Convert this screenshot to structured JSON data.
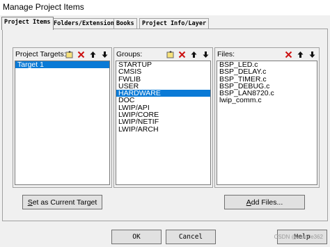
{
  "window": {
    "title": "Manage Project Items"
  },
  "tabs": [
    {
      "label": "Project Items",
      "active": true
    },
    {
      "label": "Folders/Extensions",
      "active": false
    },
    {
      "label": "Books",
      "active": false
    },
    {
      "label": "Project Info/Layer",
      "active": false
    }
  ],
  "targets": {
    "label": "Project Targets:",
    "items": [
      {
        "text": "Target 1",
        "selected": true
      }
    ],
    "tools": [
      "new-icon",
      "delete-icon",
      "move-up-icon",
      "move-down-icon"
    ]
  },
  "groups": {
    "label": "Groups:",
    "items": [
      {
        "text": "STARTUP",
        "selected": false
      },
      {
        "text": "CMSIS",
        "selected": false
      },
      {
        "text": "FWLIB",
        "selected": false
      },
      {
        "text": "USER",
        "selected": false
      },
      {
        "text": "HARDWARE",
        "selected": true
      },
      {
        "text": "DOC",
        "selected": false
      },
      {
        "text": "LWIP/API",
        "selected": false
      },
      {
        "text": "LWIP/CORE",
        "selected": false
      },
      {
        "text": "LWIP/NETIF",
        "selected": false
      },
      {
        "text": "LWIP/ARCH",
        "selected": false
      }
    ],
    "tools": [
      "new-icon",
      "delete-icon",
      "move-up-icon",
      "move-down-icon"
    ]
  },
  "files": {
    "label": "Files:",
    "items": [
      {
        "text": "BSP_LED.c",
        "selected": false
      },
      {
        "text": "BSP_DELAY.c",
        "selected": false
      },
      {
        "text": "BSP_TIMER.c",
        "selected": false
      },
      {
        "text": "BSP_DEBUG.c",
        "selected": false
      },
      {
        "text": "BSP_LAN8720.c",
        "selected": false
      },
      {
        "text": "lwip_comm.c",
        "selected": false
      }
    ],
    "tools": [
      "delete-icon",
      "move-up-icon",
      "move-down-icon"
    ]
  },
  "buttons": {
    "set_current_target": {
      "underline": "S",
      "rest": "et as Current Target"
    },
    "add_files": {
      "underline": "A",
      "rest": "dd Files..."
    },
    "ok": "OK",
    "cancel": "Cancel",
    "help": "Help"
  },
  "watermark": "CSDN @alan0e362",
  "colors": {
    "selection": "#0a7ad6",
    "delete": "#cc1111",
    "folder": "#e6c34a"
  }
}
